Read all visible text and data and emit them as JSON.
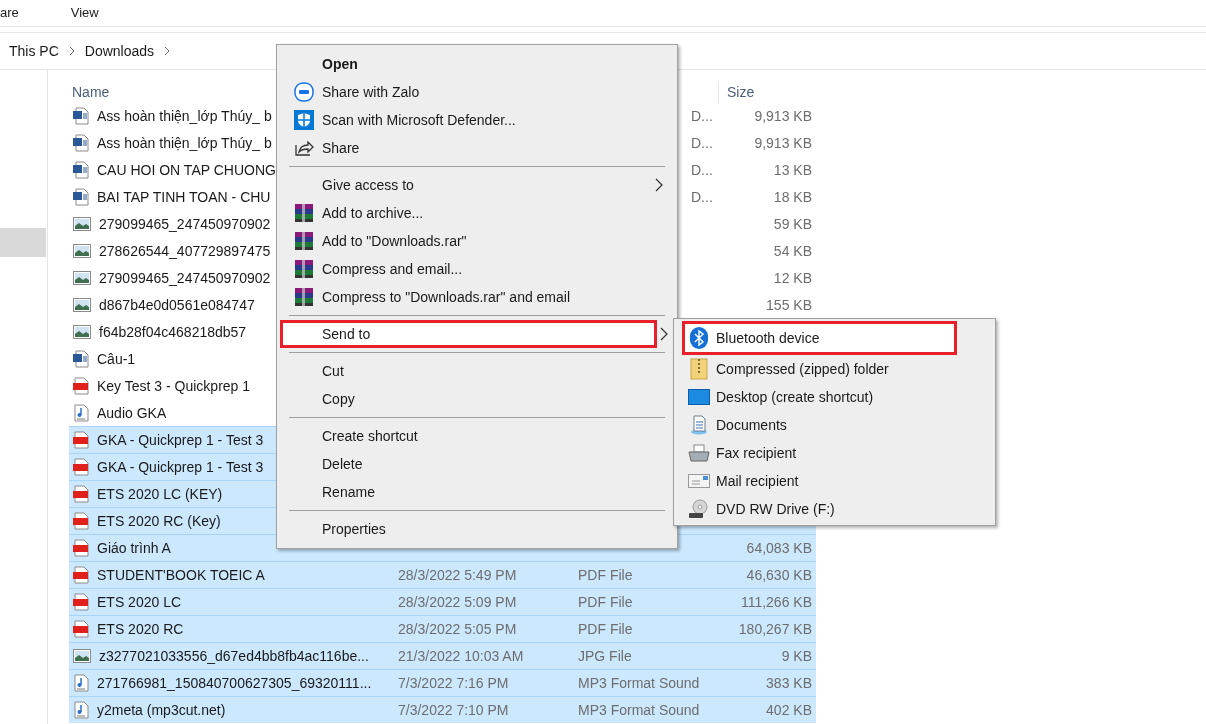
{
  "ribbon": {
    "tabs": [
      "are",
      "View"
    ]
  },
  "address": {
    "crumbs": [
      "This PC",
      "Downloads"
    ]
  },
  "sidebar": {
    "items": [
      {
        "selected": true
      }
    ]
  },
  "columns": {
    "name": "Name",
    "size": "Size"
  },
  "files": [
    {
      "kind": "word",
      "name": "Ass hoàn thiện_lớp Thúy_ b",
      "type": "D...",
      "size": "9,913 KB",
      "selected": false
    },
    {
      "kind": "word",
      "name": "Ass hoàn thiện_lớp Thúy_ b",
      "type": "D...",
      "size": "9,913 KB",
      "selected": false
    },
    {
      "kind": "word",
      "name": "CAU HOI ON TAP CHUONG",
      "type": "D...",
      "size": "13 KB",
      "selected": false
    },
    {
      "kind": "word",
      "name": "BAI TAP TINH TOAN - CHU",
      "type": "D...",
      "size": "18 KB",
      "selected": false
    },
    {
      "kind": "image",
      "name": "279099465_247450970902",
      "size": "59 KB",
      "selected": false
    },
    {
      "kind": "image",
      "name": "278626544_407729897475",
      "size": "54 KB",
      "selected": false
    },
    {
      "kind": "image",
      "name": "279099465_247450970902",
      "size": "12 KB",
      "selected": false
    },
    {
      "kind": "image",
      "name": "d867b4e0d0561e084747",
      "size": "155 KB",
      "selected": false
    },
    {
      "kind": "image",
      "name": "f64b28f04c468218db57",
      "selected": false
    },
    {
      "kind": "word",
      "name": "Câu-1",
      "selected": false
    },
    {
      "kind": "pdf",
      "name": "Key Test 3 - Quickprep 1",
      "selected": false
    },
    {
      "kind": "audio",
      "name": "Audio GKA",
      "selected": false
    },
    {
      "kind": "pdf",
      "name": "GKA - Quickprep 1 - Test 3",
      "selected": true
    },
    {
      "kind": "pdf",
      "name": "GKA - Quickprep 1 - Test 3",
      "selected": true
    },
    {
      "kind": "pdf",
      "name": "ETS 2020 LC (KEY)",
      "selected": true
    },
    {
      "kind": "pdf",
      "name": "ETS 2020 RC (Key)",
      "selected": true
    },
    {
      "kind": "pdf",
      "name": "Giáo trình A",
      "size": "64,083 KB",
      "selected": true
    },
    {
      "kind": "pdf",
      "name": "STUDENT'BOOK TOEIC A",
      "date": "28/3/2022 5:49 PM",
      "type": "PDF File",
      "size": "46,630 KB",
      "selected": true
    },
    {
      "kind": "pdf",
      "name": "ETS 2020 LC",
      "date": "28/3/2022 5:09 PM",
      "type": "PDF File",
      "size": "111,266 KB",
      "selected": true
    },
    {
      "kind": "pdf",
      "name": "ETS 2020 RC",
      "date": "28/3/2022 5:05 PM",
      "type": "PDF File",
      "size": "180,267 KB",
      "selected": true
    },
    {
      "kind": "image",
      "name": "z3277021033556_d67ed4bb8fb4ac116be...",
      "date": "21/3/2022 10:03 AM",
      "type": "JPG File",
      "size": "9 KB",
      "selected": true
    },
    {
      "kind": "audio",
      "name": "271766981_150840700627305_69320111...",
      "date": "7/3/2022 7:16 PM",
      "type": "MP3 Format Sound",
      "size": "383 KB",
      "selected": true
    },
    {
      "kind": "audio",
      "name": "y2meta (mp3cut.net)",
      "date": "7/3/2022 7:10 PM",
      "type": "MP3 Format Sound",
      "size": "402 KB",
      "selected": true
    }
  ],
  "context_menu": {
    "items": [
      {
        "kind": "item",
        "label": "Open",
        "bold": true,
        "submenu": false,
        "selected": false
      },
      {
        "kind": "item",
        "label": "Share with Zalo",
        "bold": false,
        "submenu": false,
        "selected": false
      },
      {
        "kind": "item",
        "label": "Scan with Microsoft Defender...",
        "bold": false,
        "submenu": false,
        "selected": false
      },
      {
        "kind": "item",
        "label": "Share",
        "bold": false,
        "submenu": false,
        "selected": false
      },
      {
        "kind": "separator"
      },
      {
        "kind": "item",
        "label": "Give access to",
        "bold": false,
        "submenu": true,
        "selected": false
      },
      {
        "kind": "item",
        "label": "Add to archive...",
        "bold": false,
        "submenu": false,
        "selected": false
      },
      {
        "kind": "item",
        "label": "Add to \"Downloads.rar\"",
        "bold": false,
        "submenu": false,
        "selected": false
      },
      {
        "kind": "item",
        "label": "Compress and email...",
        "bold": false,
        "submenu": false,
        "selected": false
      },
      {
        "kind": "item",
        "label": "Compress to \"Downloads.rar\" and email",
        "bold": false,
        "submenu": false,
        "selected": false
      },
      {
        "kind": "separator"
      },
      {
        "kind": "item",
        "label": "Send to",
        "bold": false,
        "submenu": true,
        "selected": true
      },
      {
        "kind": "separator"
      },
      {
        "kind": "item",
        "label": "Cut",
        "bold": false,
        "submenu": false,
        "selected": false
      },
      {
        "kind": "item",
        "label": "Copy",
        "bold": false,
        "submenu": false,
        "selected": false
      },
      {
        "kind": "separator"
      },
      {
        "kind": "item",
        "label": "Create shortcut",
        "bold": false,
        "submenu": false,
        "selected": false
      },
      {
        "kind": "item",
        "label": "Delete",
        "bold": false,
        "submenu": false,
        "selected": false
      },
      {
        "kind": "item",
        "label": "Rename",
        "bold": false,
        "submenu": false,
        "selected": false
      },
      {
        "kind": "separator"
      },
      {
        "kind": "item",
        "label": "Properties",
        "bold": false,
        "submenu": false,
        "selected": false
      }
    ]
  },
  "send_to_menu": {
    "items": [
      {
        "label": "Bluetooth device",
        "selected": true
      },
      {
        "label": "Compressed (zipped) folder",
        "selected": false
      },
      {
        "label": "Desktop (create shortcut)",
        "selected": false
      },
      {
        "label": "Documents",
        "selected": false
      },
      {
        "label": "Fax recipient",
        "selected": false
      },
      {
        "label": "Mail recipient",
        "selected": false
      },
      {
        "label": "DVD RW Drive (F:)",
        "selected": false
      }
    ]
  }
}
